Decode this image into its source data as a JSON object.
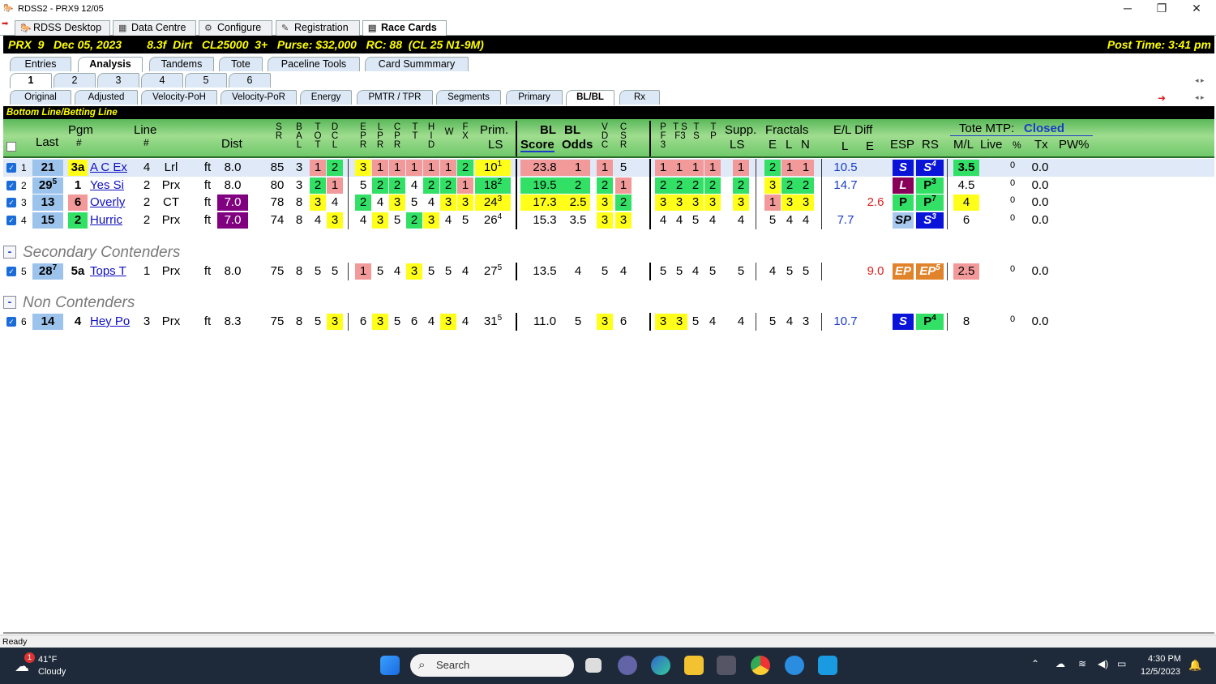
{
  "window": {
    "title": "RDSS2 - PRX9  12/05"
  },
  "top_tabs": [
    {
      "label": "RDSS Desktop",
      "icon": "horse-icon"
    },
    {
      "label": "Data Centre",
      "icon": "data-icon"
    },
    {
      "label": "Configure",
      "icon": "gear-icon"
    },
    {
      "label": "Registration",
      "icon": "registration-icon"
    },
    {
      "label": "Race Cards",
      "icon": "card-icon"
    }
  ],
  "race": {
    "info": "PRX  9   Dec 05, 2023        8.3f  Dirt   CL25000  3+   Purse: $32,000   RC: 88  (CL 25 N1-9M)",
    "post_time": "Post Time: 3:41 pm"
  },
  "main_tabs": [
    "Entries",
    "Analysis",
    "Tandems",
    "Tote",
    "Paceline Tools",
    "Card Summmary"
  ],
  "number_tabs": [
    "1",
    "2",
    "3",
    "4",
    "5",
    "6"
  ],
  "sub_tabs": [
    "Original",
    "Adjusted",
    "Velocity-PoH",
    "Velocity-PoR",
    "Energy",
    "PMTR / TPR",
    "Segments",
    "Primary",
    "BL/BL",
    "Rx"
  ],
  "section_title": "Bottom Line/Betting Line",
  "headers": {
    "last": "Last",
    "pgm": "Pgm",
    "pgm_num": "#",
    "line": "Line",
    "line_num": "#",
    "dist": "Dist",
    "sr": "S R",
    "bal": "B A L",
    "tot": "T O T",
    "dcl": "D C L",
    "epr": "E P R",
    "lpr": "L P R",
    "cpr": "C P R",
    "tt": "T T",
    "hid": "H I D",
    "w": "W",
    "fx": "F X",
    "prim": "Prim.",
    "prim_ls": "LS",
    "bl1": "BL",
    "bl2": "BL",
    "score": "Score",
    "odds": "Odds",
    "vdc": "V D C",
    "csr": "C S R",
    "pf3": "P F 3",
    "tsf3": "T S F3",
    "ts": "T S",
    "tp": "T P",
    "supp": "Supp.",
    "supp_ls": "LS",
    "fractals": "Fractals",
    "fe": "E",
    "fl": "L",
    "fn": "N",
    "eldiff": "E/L Diff",
    "el_l": "L",
    "el_e": "E",
    "esp": "ESP",
    "rs": "RS",
    "tote": "Tote MTP:",
    "tote_status": "Closed",
    "ml": "M/L",
    "live": "Live",
    "pct": "%",
    "tx": "Tx",
    "pw": "PW%"
  },
  "contenders": [
    {
      "idx": "1",
      "last": "21",
      "last_sup": "",
      "pgm": "3a",
      "name": "A C Ex",
      "line": "4",
      "trk": "Lrl",
      "surf": "ft",
      "dist": "8.0",
      "sr": "85",
      "bal": "3",
      "tot": "1",
      "dcl": "2",
      "epr": "3",
      "lpr": "1",
      "cpr": "1",
      "tt": "1",
      "hid": "1",
      "w": "1",
      "fx": "2",
      "prim": "10",
      "prim_sup": "1",
      "score": "23.8",
      "odds": "1",
      "vdc": "1",
      "csr": "5",
      "pf3": "1",
      "tsf3": "1",
      "ts": "1",
      "tp": "1",
      "supp": "1",
      "fe": "2",
      "fl": "1",
      "fn": "1",
      "el_l": "10.5",
      "el_e": "",
      "esp": "S",
      "rs": "S",
      "rs_sup": "4",
      "ml": "3.5",
      "live": "",
      "pct": "0",
      "tx": "0.0"
    },
    {
      "idx": "2",
      "last": "29",
      "last_sup": "5",
      "pgm": "1",
      "name": "Yes Si",
      "line": "2",
      "trk": "Prx",
      "surf": "ft",
      "dist": "8.0",
      "sr": "80",
      "bal": "3",
      "tot": "2",
      "dcl": "1",
      "epr": "5",
      "lpr": "2",
      "cpr": "2",
      "tt": "4",
      "hid": "2",
      "w": "2",
      "fx": "1",
      "prim": "18",
      "prim_sup": "2",
      "score": "19.5",
      "odds": "2",
      "vdc": "2",
      "csr": "1",
      "pf3": "2",
      "tsf3": "2",
      "ts": "2",
      "tp": "2",
      "supp": "2",
      "fe": "3",
      "fl": "2",
      "fn": "2",
      "el_l": "14.7",
      "el_e": "",
      "esp": "L",
      "rs": "P",
      "rs_sup": "3",
      "ml": "4.5",
      "live": "",
      "pct": "0",
      "tx": "0.0"
    },
    {
      "idx": "3",
      "last": "13",
      "last_sup": "",
      "pgm": "6",
      "name": "Overly",
      "line": "2",
      "trk": "CT",
      "surf": "ft",
      "dist": "7.0",
      "sr": "78",
      "bal": "8",
      "tot": "3",
      "dcl": "4",
      "epr": "2",
      "lpr": "4",
      "cpr": "3",
      "tt": "5",
      "hid": "4",
      "w": "3",
      "fx": "3",
      "prim": "24",
      "prim_sup": "3",
      "score": "17.3",
      "odds": "2.5",
      "vdc": "3",
      "csr": "2",
      "pf3": "3",
      "tsf3": "3",
      "ts": "3",
      "tp": "3",
      "supp": "3",
      "fe": "1",
      "fl": "3",
      "fn": "3",
      "el_l": "",
      "el_e": "2.6",
      "esp": "P",
      "rs": "P",
      "rs_sup": "7",
      "ml": "4",
      "live": "",
      "pct": "0",
      "tx": "0.0"
    },
    {
      "idx": "4",
      "last": "15",
      "last_sup": "",
      "pgm": "2",
      "name": "Hurric",
      "line": "2",
      "trk": "Prx",
      "surf": "ft",
      "dist": "7.0",
      "sr": "74",
      "bal": "8",
      "tot": "4",
      "dcl": "3",
      "epr": "4",
      "lpr": "3",
      "cpr": "5",
      "tt": "2",
      "hid": "3",
      "w": "4",
      "fx": "5",
      "prim": "26",
      "prim_sup": "4",
      "score": "15.3",
      "odds": "3.5",
      "vdc": "3",
      "csr": "3",
      "pf3": "4",
      "tsf3": "4",
      "ts": "5",
      "tp": "4",
      "supp": "4",
      "fe": "5",
      "fl": "4",
      "fn": "4",
      "el_l": "7.7",
      "el_e": "",
      "esp": "SP",
      "rs": "S",
      "rs_sup": "3",
      "ml": "6",
      "live": "",
      "pct": "0",
      "tx": "0.0"
    }
  ],
  "groups": {
    "secondary": "Secondary Contenders",
    "non": "Non Contenders",
    "collapse": "-"
  },
  "secondary": [
    {
      "idx": "5",
      "last": "28",
      "last_sup": "7",
      "pgm": "5a",
      "name": "Tops T",
      "line": "1",
      "trk": "Prx",
      "surf": "ft",
      "dist": "8.0",
      "sr": "75",
      "bal": "8",
      "tot": "5",
      "dcl": "5",
      "epr": "1",
      "lpr": "5",
      "cpr": "4",
      "tt": "3",
      "hid": "5",
      "w": "5",
      "fx": "4",
      "prim": "27",
      "prim_sup": "5",
      "score": "13.5",
      "odds": "4",
      "vdc": "5",
      "csr": "4",
      "pf3": "5",
      "tsf3": "5",
      "ts": "4",
      "tp": "5",
      "supp": "5",
      "fe": "4",
      "fl": "5",
      "fn": "5",
      "el_l": "",
      "el_e": "9.0",
      "esp": "EP",
      "rs": "EP",
      "rs_sup": "5",
      "ml": "2.5",
      "live": "",
      "pct": "0",
      "tx": "0.0"
    }
  ],
  "non": [
    {
      "idx": "6",
      "last": "14",
      "last_sup": "",
      "pgm": "4",
      "name": "Hey Po",
      "line": "3",
      "trk": "Prx",
      "surf": "ft",
      "dist": "8.3",
      "sr": "75",
      "bal": "8",
      "tot": "5",
      "dcl": "3",
      "epr": "6",
      "lpr": "3",
      "cpr": "5",
      "tt": "6",
      "hid": "4",
      "w": "3",
      "fx": "4",
      "prim": "31",
      "prim_sup": "5",
      "score": "11.0",
      "odds": "5",
      "vdc": "3",
      "csr": "6",
      "pf3": "3",
      "tsf3": "3",
      "ts": "5",
      "tp": "4",
      "supp": "4",
      "fe": "5",
      "fl": "4",
      "fn": "3",
      "el_l": "10.7",
      "el_e": "",
      "esp": "S",
      "rs": "P",
      "rs_sup": "4",
      "ml": "8",
      "live": "",
      "pct": "0",
      "tx": "0.0"
    }
  ],
  "status": "Ready",
  "taskbar": {
    "temp": "41°F",
    "weather": "Cloudy",
    "badge": "1",
    "search": "Search",
    "time": "4:30 PM",
    "date": "12/5/2023"
  }
}
